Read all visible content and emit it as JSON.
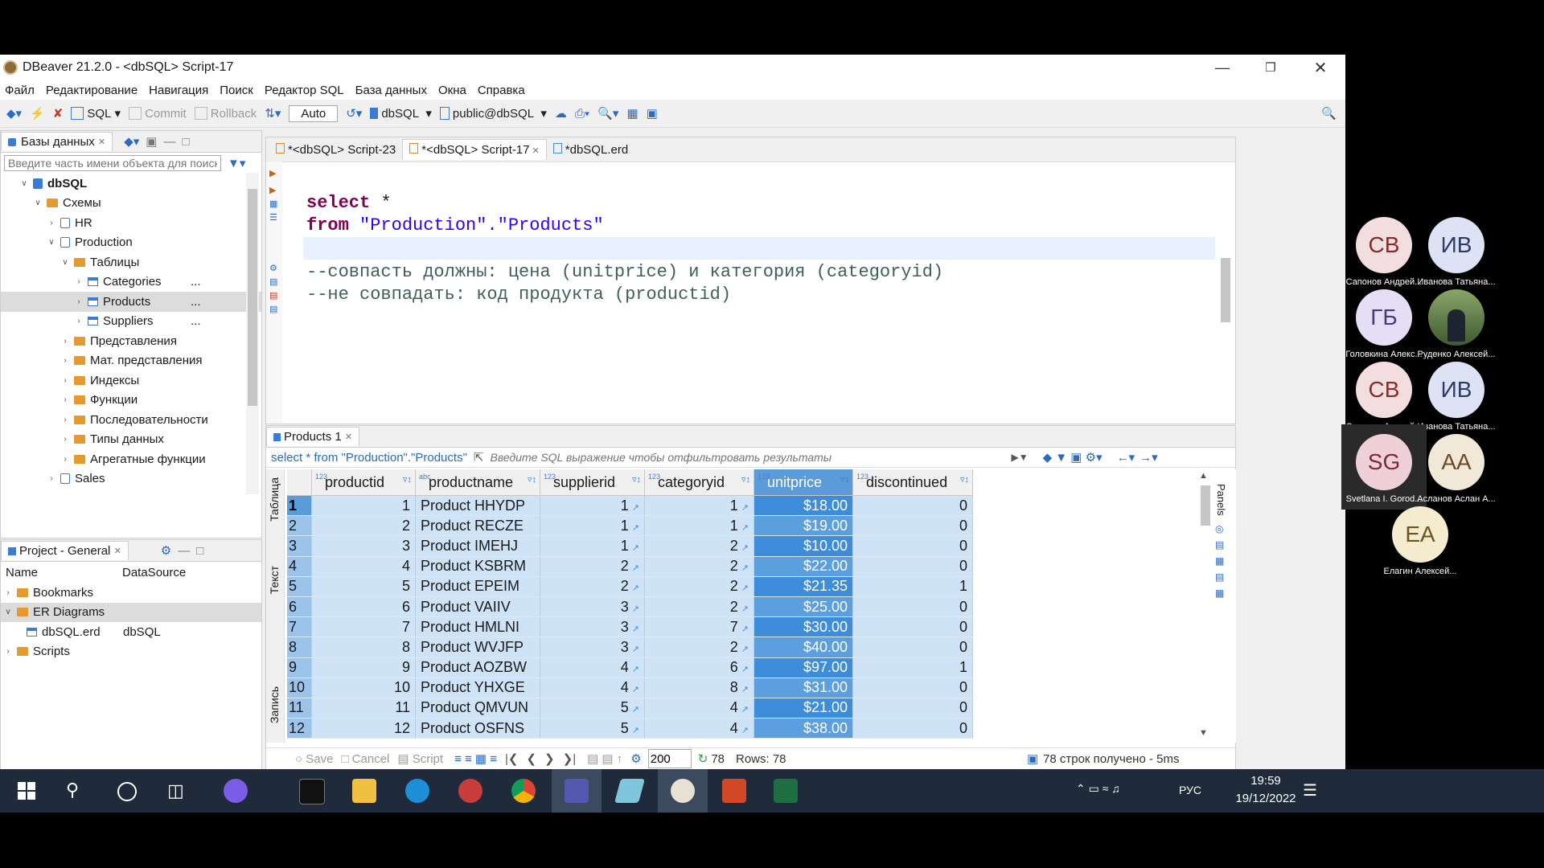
{
  "window": {
    "title": "DBeaver 21.2.0 - <dbSQL> Script-17"
  },
  "menu": [
    "Файл",
    "Редактирование",
    "Навигация",
    "Поиск",
    "Редактор SQL",
    "База данных",
    "Окна",
    "Справка"
  ],
  "toolbar": {
    "sql": "SQL",
    "commit": "Commit",
    "rollback": "Rollback",
    "auto": "Auto",
    "datasource": "dbSQL",
    "schema": "public@dbSQL"
  },
  "db_panel": {
    "tab": "Базы данных",
    "filter_placeholder": "Введите часть имени объекта для поиска",
    "tree": [
      {
        "label": "dbSQL",
        "level": 0,
        "icon": "database-icon",
        "expanded": true,
        "bold": true
      },
      {
        "label": "Схемы",
        "level": 1,
        "icon": "folder-icon",
        "expanded": true
      },
      {
        "label": "HR",
        "level": 2,
        "icon": "schema-icon",
        "expanded": false
      },
      {
        "label": "Production",
        "level": 2,
        "icon": "schema-icon",
        "expanded": true
      },
      {
        "label": "Таблицы",
        "level": 3,
        "icon": "folder-icon",
        "expanded": true
      },
      {
        "label": "Categories",
        "level": 4,
        "icon": "table-icon",
        "expanded": false,
        "more": "..."
      },
      {
        "label": "Products",
        "level": 4,
        "icon": "table-icon",
        "expanded": false,
        "selected": true,
        "more": "..."
      },
      {
        "label": "Suppliers",
        "level": 4,
        "icon": "table-icon",
        "expanded": false,
        "more": "..."
      },
      {
        "label": "Представления",
        "level": 3,
        "icon": "folder-icon",
        "expanded": false
      },
      {
        "label": "Мат. представления",
        "level": 3,
        "icon": "folder-icon",
        "expanded": false
      },
      {
        "label": "Индексы",
        "level": 3,
        "icon": "folder-icon",
        "expanded": false
      },
      {
        "label": "Функции",
        "level": 3,
        "icon": "folder-icon",
        "expanded": false
      },
      {
        "label": "Последовательности",
        "level": 3,
        "icon": "folder-icon",
        "expanded": false
      },
      {
        "label": "Типы данных",
        "level": 3,
        "icon": "folder-icon",
        "expanded": false
      },
      {
        "label": "Агрегатные функции",
        "level": 3,
        "icon": "folder-icon",
        "expanded": false
      },
      {
        "label": "Sales",
        "level": 2,
        "icon": "schema-icon",
        "expanded": false
      }
    ]
  },
  "project_panel": {
    "tab": "Project - General",
    "col_name": "Name",
    "col_ds": "DataSource",
    "rows": [
      {
        "label": "Bookmarks",
        "level": 0,
        "ds": ""
      },
      {
        "label": "ER Diagrams",
        "level": 0,
        "ds": "",
        "expanded": true,
        "selected": true
      },
      {
        "label": "dbSQL.erd",
        "level": 1,
        "ds": "dbSQL"
      },
      {
        "label": "Scripts",
        "level": 0,
        "ds": ""
      }
    ]
  },
  "editor_tabs": [
    "*<dbSQL> Script-23",
    "*<dbSQL> Script-17",
    "*dbSQL.erd"
  ],
  "code": {
    "l1_kw": "select",
    "l1_rest": " *",
    "l2_kw": "from",
    "l2_str": "\"Production\".\"Products\"",
    "c1": "--совпасть должны: цена (unitprice) и категория (categoryid)",
    "c2": "--не совпадать: код продукта (productid)"
  },
  "results": {
    "tab": "Products 1",
    "query": "select * from \"Production\".\"Products\"",
    "filter_placeholder": "Введите SQL выражение чтобы отфильтровать результаты",
    "side_left": [
      "Таблица",
      "Текст",
      "Запись"
    ],
    "side_right": "Panels",
    "columns": [
      {
        "name": "productid",
        "type": "123"
      },
      {
        "name": "productname",
        "type": "abc"
      },
      {
        "name": "supplierid",
        "type": "123"
      },
      {
        "name": "categoryid",
        "type": "123"
      },
      {
        "name": "unitprice",
        "type": "123"
      },
      {
        "name": "discontinued",
        "type": "123"
      }
    ],
    "rows": [
      [
        "1",
        "1",
        "Product HHYDP",
        "1",
        "1",
        "$18.00",
        "0"
      ],
      [
        "2",
        "2",
        "Product RECZE",
        "1",
        "1",
        "$19.00",
        "0"
      ],
      [
        "3",
        "3",
        "Product IMEHJ",
        "1",
        "2",
        "$10.00",
        "0"
      ],
      [
        "4",
        "4",
        "Product KSBRM",
        "2",
        "2",
        "$22.00",
        "0"
      ],
      [
        "5",
        "5",
        "Product EPEIM",
        "2",
        "2",
        "$21.35",
        "1"
      ],
      [
        "6",
        "6",
        "Product VAIIV",
        "3",
        "2",
        "$25.00",
        "0"
      ],
      [
        "7",
        "7",
        "Product HMLNI",
        "3",
        "7",
        "$30.00",
        "0"
      ],
      [
        "8",
        "8",
        "Product WVJFP",
        "3",
        "2",
        "$40.00",
        "0"
      ],
      [
        "9",
        "9",
        "Product AOZBW",
        "4",
        "6",
        "$97.00",
        "1"
      ],
      [
        "10",
        "10",
        "Product YHXGE",
        "4",
        "8",
        "$31.00",
        "0"
      ],
      [
        "11",
        "11",
        "Product QMVUN",
        "5",
        "4",
        "$21.00",
        "0"
      ],
      [
        "12",
        "12",
        "Product OSFNS",
        "5",
        "4",
        "$38.00",
        "0"
      ]
    ],
    "status": {
      "save": "Save",
      "cancel": "Cancel",
      "script": "Script",
      "fetch": "200",
      "count": "78",
      "rows": "Rows: 78",
      "fetched": "78 строк получено - 5ms"
    }
  },
  "participants": [
    {
      "initials": "СВ",
      "name": "Сапонов Андрей...",
      "color": "#f2dede",
      "text": "#8a2b2b"
    },
    {
      "initials": "ИВ",
      "name": "Иванова Татьяна...",
      "color": "#dde3f5",
      "text": "#2e3b66"
    },
    {
      "initials": "ГБ",
      "name": "Головкина Алекс...",
      "color": "#e5def5",
      "text": "#4b3a7a"
    },
    {
      "initials": "",
      "name": "Руденко Алексей...",
      "color": "#5d7a4a",
      "text": "#fff",
      "photo": true
    },
    {
      "initials": "СВ",
      "name": "Сапонов Андрей...",
      "color": "#f2dede",
      "text": "#8a2b2b"
    },
    {
      "initials": "ИВ",
      "name": "Иванова Татьяна...",
      "color": "#dde3f5",
      "text": "#2e3b66"
    },
    {
      "initials": "SG",
      "name": "Svetlana I. Gorod...",
      "color": "#f0d0d8",
      "text": "#7a2a3c",
      "active": true
    },
    {
      "initials": "AA",
      "name": "Асланов Аслан А...",
      "color": "#f2e8d8",
      "text": "#6a4b2a"
    },
    {
      "initials": "EA",
      "name": "Елагин Алексей...",
      "color": "#f5ecd0",
      "text": "#6a5520"
    }
  ],
  "taskbar": {
    "lang": "РУС",
    "time": "19:59",
    "date": "19/12/2022"
  }
}
